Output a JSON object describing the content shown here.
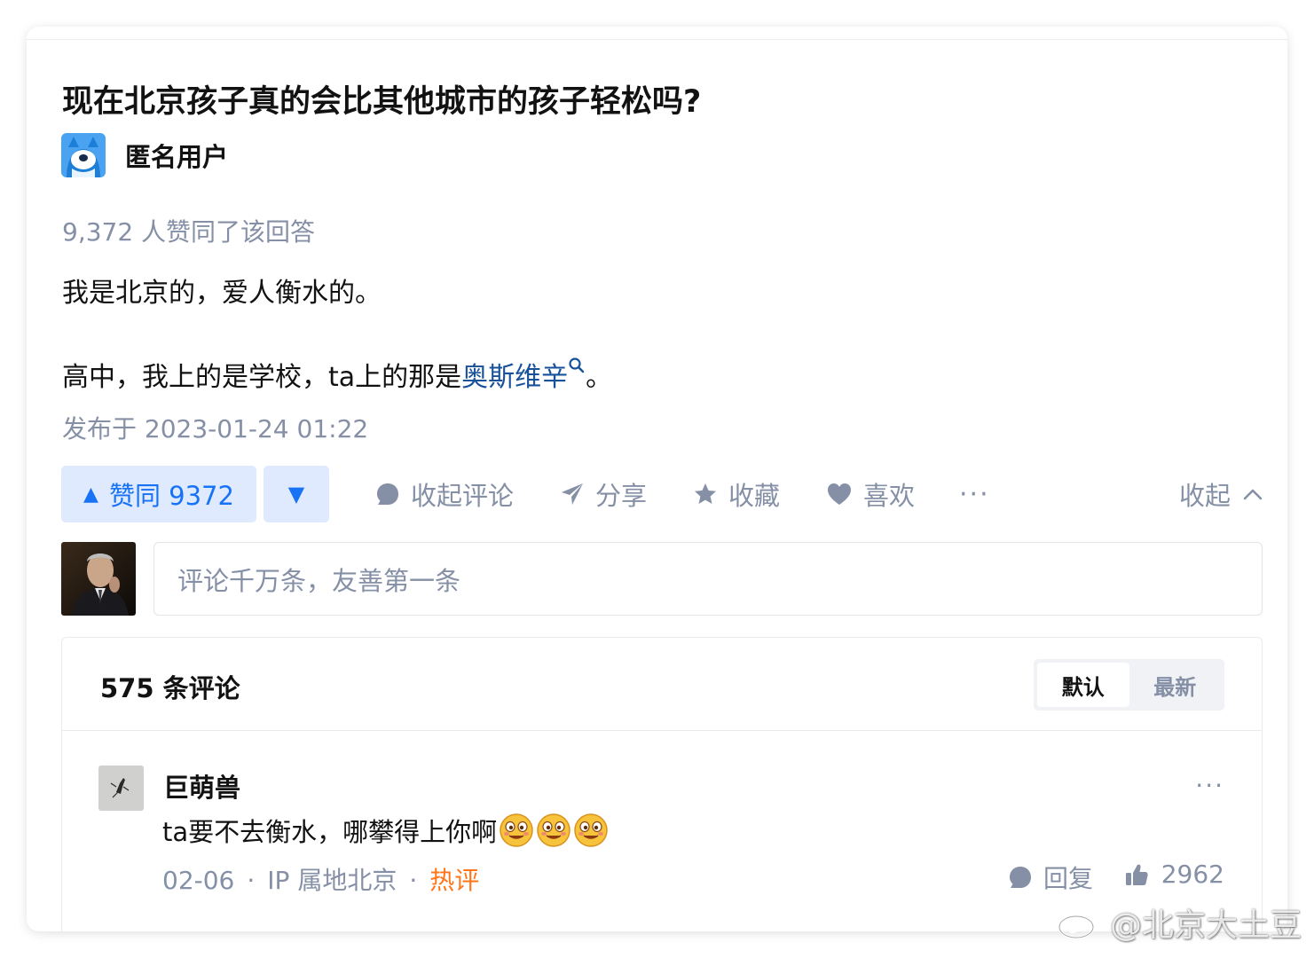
{
  "question": {
    "title": "现在北京孩子真的会比其他城市的孩子轻松吗?"
  },
  "author": {
    "name": "匿名用户",
    "avatar": "anonymous-avatar"
  },
  "answer": {
    "votes_line": "9,372 人赞同了该回答",
    "paragraph1": "我是北京的，爱人衡水的。",
    "paragraph2_before": "高中，我上的是学校，ta上的那是",
    "paragraph2_link": "奥斯维辛",
    "paragraph2_after": "。",
    "published": "发布于 2023-01-24 01:22"
  },
  "actions": {
    "vote_up": "赞同 9372",
    "comment": "收起评论",
    "share": "分享",
    "favorite": "收藏",
    "like": "喜欢",
    "more": "···",
    "collapse": "收起"
  },
  "comment_input": {
    "placeholder": "评论千万条，友善第一条"
  },
  "comments": {
    "count_label": "575 条评论",
    "sort": {
      "default": "默认",
      "latest": "最新",
      "active": "默认"
    },
    "items": [
      {
        "author": "巨萌兽",
        "text": "ta要不去衡水，哪攀得上你啊",
        "emoji": "drooling-face-emoji",
        "date": "02-06",
        "ip": "IP 属地北京",
        "tag": "热评",
        "reply": "回复",
        "likes": "2962"
      }
    ]
  },
  "watermark": {
    "text": "@北京大土豆"
  },
  "colors": {
    "accent": "#1772f6",
    "muted": "#8590a6",
    "link": "#175199",
    "hot": "#ff761a",
    "vote_bg": "#dfeaff"
  }
}
